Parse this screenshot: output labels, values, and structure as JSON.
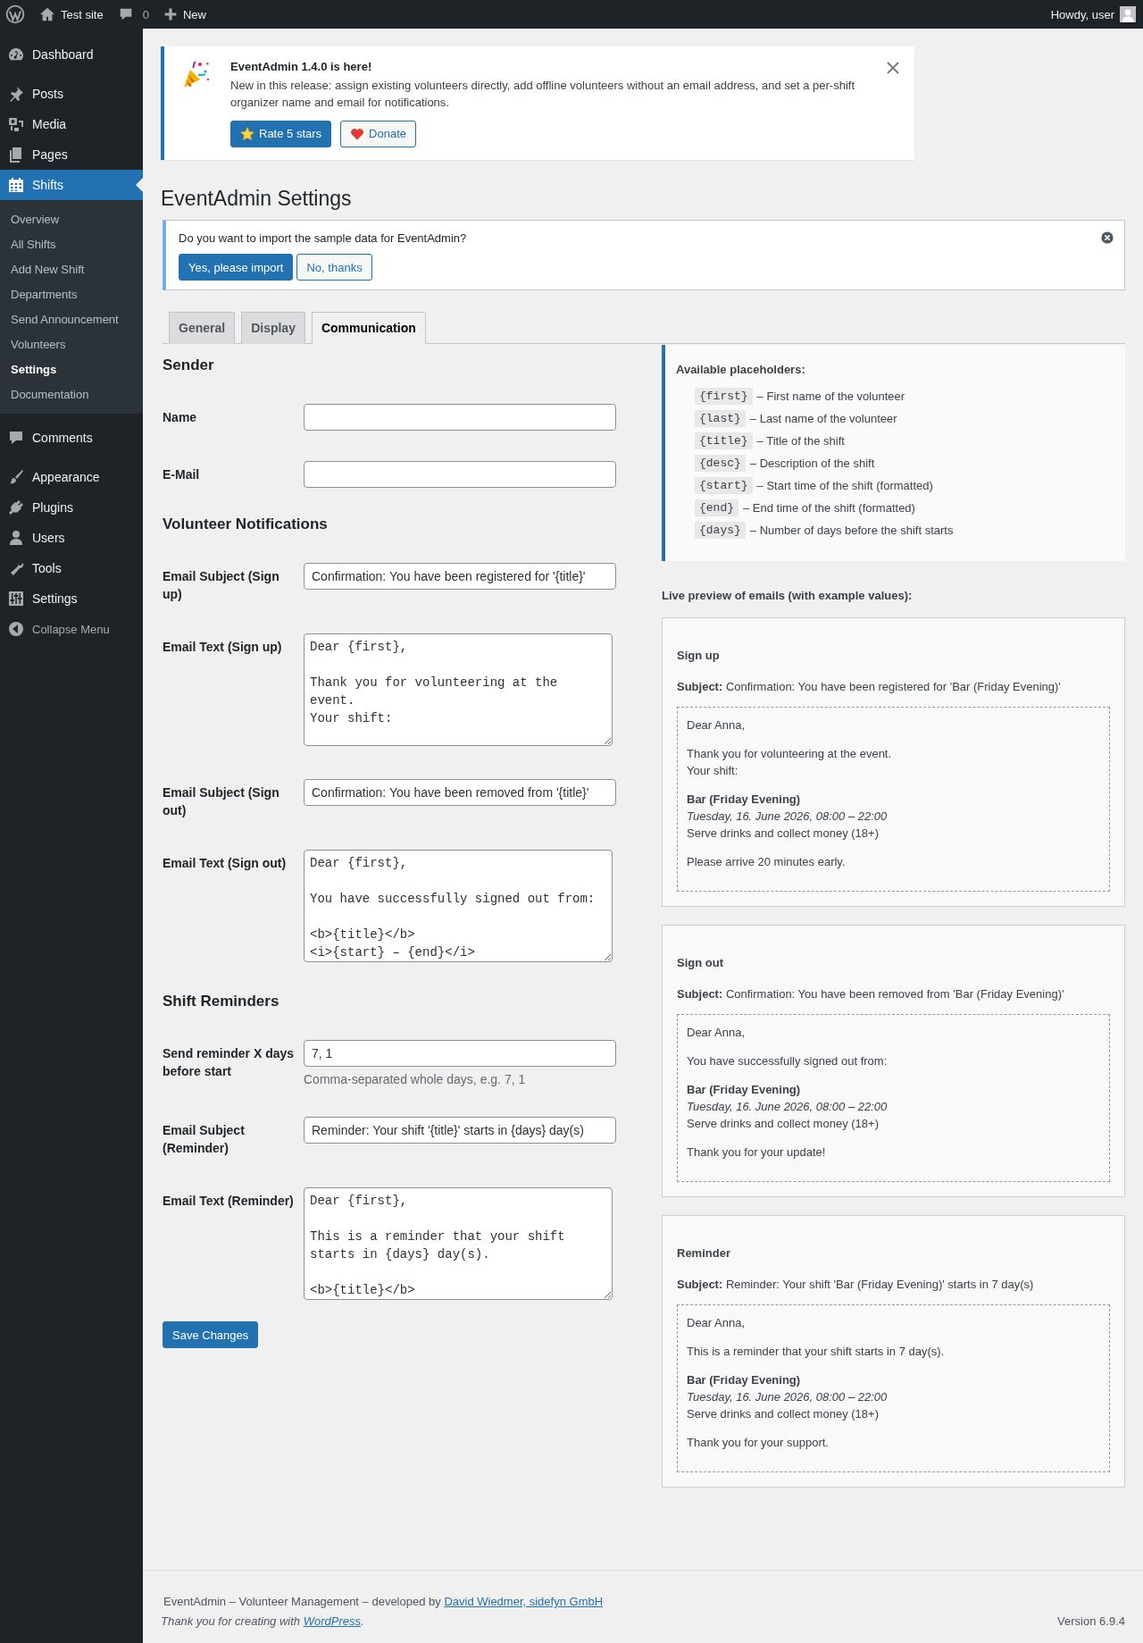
{
  "admin_bar": {
    "site_name": "Test site",
    "comment_count": "0",
    "new_label": "New",
    "greeting": "Howdy, user"
  },
  "sidebar": {
    "groups": [
      {
        "items": [
          {
            "label": "Dashboard",
            "selected": false
          }
        ]
      },
      {
        "items": [
          {
            "label": "Posts",
            "selected": false
          },
          {
            "label": "Media",
            "selected": false
          },
          {
            "label": "Pages",
            "selected": false
          },
          {
            "label": "Shifts",
            "selected": true,
            "children": [
              {
                "label": "Overview",
                "selected": false
              },
              {
                "label": "All Shifts",
                "selected": false
              },
              {
                "label": "Add New Shift",
                "selected": false
              },
              {
                "label": "Departments",
                "selected": false
              },
              {
                "label": "Send Announcement",
                "selected": false
              },
              {
                "label": "Volunteers",
                "selected": false
              },
              {
                "label": "Settings",
                "selected": true
              },
              {
                "label": "Documentation",
                "selected": false
              }
            ]
          }
        ]
      },
      {
        "items": [
          {
            "label": "Comments",
            "selected": false
          }
        ]
      },
      {
        "items": [
          {
            "label": "Appearance",
            "selected": false
          },
          {
            "label": "Plugins",
            "selected": false
          },
          {
            "label": "Users",
            "selected": false
          },
          {
            "label": "Tools",
            "selected": false
          },
          {
            "label": "Settings",
            "selected": false
          }
        ]
      }
    ],
    "collapse_label": "Collapse Menu"
  },
  "release_notice": {
    "title": "EventAdmin 1.4.0 is here!",
    "text": "New in this release: assign existing volunteers directly, add offline volunteers without an email address, and set a per-shift organizer name and email for notifications.",
    "buttons": [
      {
        "label": "Rate 5 stars",
        "kind": "primary"
      },
      {
        "label": "Donate",
        "kind": "secondary"
      }
    ]
  },
  "page_title": "EventAdmin Settings",
  "import_notice": {
    "text": "Do you want to import the sample data for EventAdmin?",
    "buttons": [
      {
        "label": "Yes, please import",
        "kind": "primary"
      },
      {
        "label": "No, thanks",
        "kind": "secondary"
      }
    ]
  },
  "tabs": [
    {
      "label": "General",
      "selected": false
    },
    {
      "label": "Display",
      "selected": false
    },
    {
      "label": "Communication",
      "selected": true
    }
  ],
  "sections": [
    {
      "heading": "Sender",
      "fields": [
        {
          "label": "Name",
          "kind": "input"
        },
        {
          "label": "E-Mail",
          "kind": "input"
        }
      ]
    },
    {
      "heading": "Volunteer Notifications",
      "fields": [
        {
          "label": "Email Subject (Sign up)",
          "kind": "input",
          "value": "Confirmation: You have been registered for '{title}'"
        },
        {
          "label": "Email Text (Sign up)",
          "kind": "textarea",
          "value": "Dear {first},\n\nThank you for volunteering at the event.\nYour shift:"
        },
        {
          "label": "Email Subject (Sign out)",
          "kind": "input",
          "value": "Confirmation: You have been removed from '{title}'"
        },
        {
          "label": "Email Text (Sign out)",
          "kind": "textarea",
          "value": "Dear {first},\n\nYou have successfully signed out from:\n\n<b>{title}</b>\n<i>{start} – {end}</i>"
        }
      ]
    },
    {
      "heading": "Shift Reminders",
      "fields": [
        {
          "label": "Send reminder X days before start",
          "kind": "input",
          "value": "7, 1",
          "description": "Comma-separated whole days, e.g. 7, 1"
        },
        {
          "label": "Email Subject (Reminder)",
          "kind": "input",
          "value": "Reminder: Your shift '{title}' starts in {days} day(s)"
        },
        {
          "label": "Email Text (Reminder)",
          "kind": "textarea",
          "value": "Dear {first},\n\nThis is a reminder that your shift starts in {days} day(s).\n\n<b>{title}</b>"
        }
      ]
    }
  ],
  "save_button": "Save Changes",
  "placeholders": {
    "title": "Available placeholders:",
    "items": [
      {
        "code": "{first}",
        "text": "– First name of the volunteer"
      },
      {
        "code": "{last}",
        "text": "– Last name of the volunteer"
      },
      {
        "code": "{title}",
        "text": "– Title of the shift"
      },
      {
        "code": "{desc}",
        "text": "– Description of the shift"
      },
      {
        "code": "{start}",
        "text": "– Start time of the shift (formatted)"
      },
      {
        "code": "{end}",
        "text": "– End time of the shift (formatted)"
      },
      {
        "code": "{days}",
        "text": "– Number of days before the shift starts"
      }
    ]
  },
  "preview": {
    "title": "Live preview of emails (with example values):",
    "emails": [
      {
        "heading": "Sign up",
        "subject": "**Subject:** Confirmation: You have been registered for 'Bar (Friday Evening)'",
        "body": [
          {
            "kind": "text",
            "lines": [
              "Dear Anna,"
            ]
          },
          {
            "kind": "text",
            "lines": [
              "Thank you for volunteering at the event.",
              "Your shift:"
            ]
          },
          {
            "kind": "shift",
            "title": "Bar (Friday Evening)",
            "time": "Tuesday, 16. June 2026, 08:00 – 22:00",
            "description": "Serve drinks and collect money (18+)"
          },
          {
            "kind": "text",
            "lines": [
              "Please arrive 20 minutes early."
            ]
          }
        ]
      },
      {
        "heading": "Sign out",
        "subject": "**Subject:** Confirmation: You have been removed from 'Bar (Friday Evening)'",
        "body": [
          {
            "kind": "text",
            "lines": [
              "Dear Anna,"
            ]
          },
          {
            "kind": "text",
            "lines": [
              "You have successfully signed out from:"
            ]
          },
          {
            "kind": "shift",
            "title": "Bar (Friday Evening)",
            "time": "Tuesday, 16. June 2026, 08:00 – 22:00",
            "description": "Serve drinks and collect money (18+)"
          },
          {
            "kind": "text",
            "lines": [
              "Thank you for your update!"
            ]
          }
        ]
      },
      {
        "heading": "Reminder",
        "subject": "**Subject:** Reminder: Your shift 'Bar (Friday Evening)' starts in 7 day(s)",
        "body": [
          {
            "kind": "text",
            "lines": [
              "Dear Anna,"
            ]
          },
          {
            "kind": "text",
            "lines": [
              "This is a reminder that your shift starts in 7 day(s)."
            ]
          },
          {
            "kind": "shift",
            "title": "Bar (Friday Evening)",
            "time": "Tuesday, 16. June 2026, 08:00 – 22:00",
            "description": "Serve drinks and collect money (18+)"
          },
          {
            "kind": "text",
            "lines": [
              "Thank you for your support."
            ]
          }
        ]
      }
    ]
  },
  "footer": {
    "credit": "EventAdmin – Volunteer Management – developed by ",
    "credit_link": "David Wiedmer, sidefyn GmbH",
    "thanks": "Thank you for creating with ",
    "thanks_link": "WordPress",
    "thanks_end": ".",
    "version": "Version 6.9.4"
  }
}
